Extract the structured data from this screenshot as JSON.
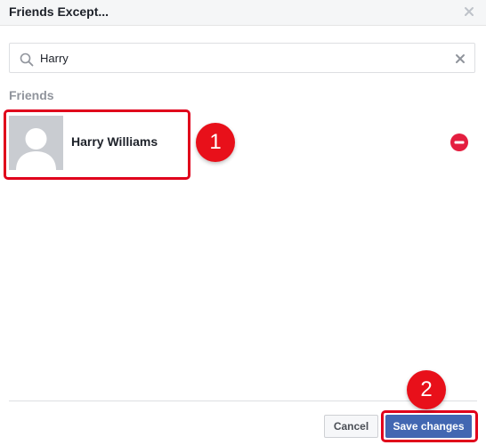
{
  "dialog": {
    "title": "Friends Except...",
    "close_icon": "close-icon"
  },
  "search": {
    "value": "Harry",
    "placeholder": "",
    "icon": "search-icon",
    "clear_icon": "clear-icon"
  },
  "friends_section": {
    "label": "Friends",
    "items": [
      {
        "name": "Harry Williams",
        "avatar": "default-avatar",
        "remove_icon": "minus-circle-icon"
      }
    ]
  },
  "annotations": [
    {
      "label": "1",
      "color": "#e8101a"
    },
    {
      "label": "2",
      "color": "#e8101a"
    }
  ],
  "footer": {
    "cancel_label": "Cancel",
    "save_label": "Save changes"
  },
  "colors": {
    "accent": "#4267b2",
    "remove": "#e41e3f",
    "annotation": "#e0001b"
  }
}
